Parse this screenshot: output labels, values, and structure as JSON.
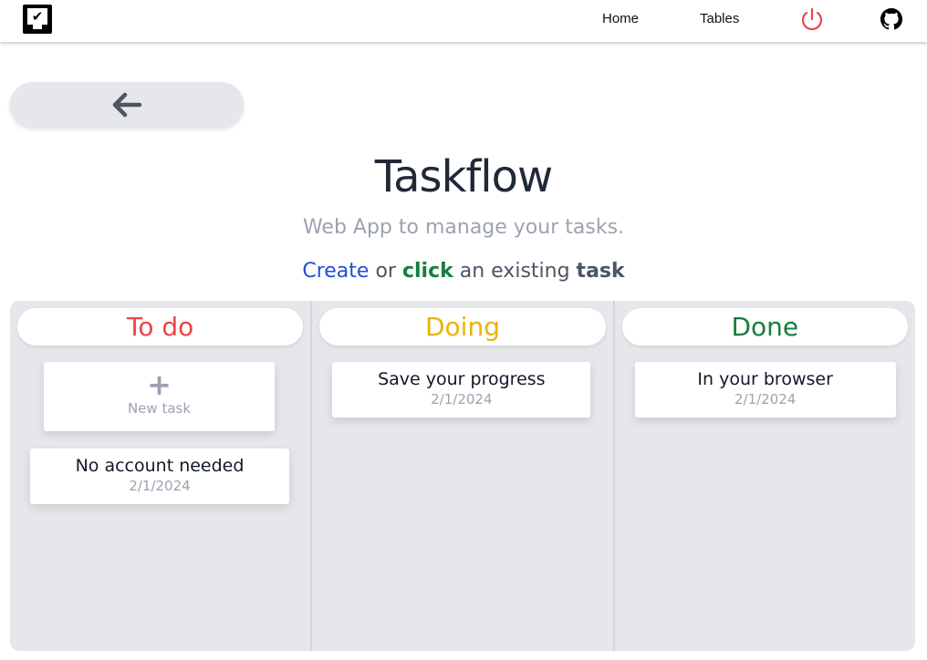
{
  "nav": {
    "logo": "taskflow-logo",
    "links": [
      "Home",
      "Tables"
    ],
    "logout_icon": "power-icon",
    "github_icon": "github-icon"
  },
  "back_icon": "arrow-left-icon",
  "header": {
    "title": "Taskflow",
    "subtitle": "Web App to manage your tasks.",
    "cta": {
      "create": "Create",
      "or": " or ",
      "click": "click",
      "middle": " an existing ",
      "task": "task"
    }
  },
  "colors": {
    "todo": "#ef4444",
    "doing": "#eab308",
    "done": "#15803d",
    "create": "#1d4ed8",
    "click": "#15803d"
  },
  "columns": [
    {
      "title": "To do",
      "new_task": "New task",
      "tasks": [
        {
          "title": "No account needed",
          "date": "2/1/2024"
        }
      ]
    },
    {
      "title": "Doing",
      "tasks": [
        {
          "title": "Save your progress",
          "date": "2/1/2024"
        }
      ]
    },
    {
      "title": "Done",
      "tasks": [
        {
          "title": "In your browser",
          "date": "2/1/2024"
        }
      ]
    }
  ]
}
